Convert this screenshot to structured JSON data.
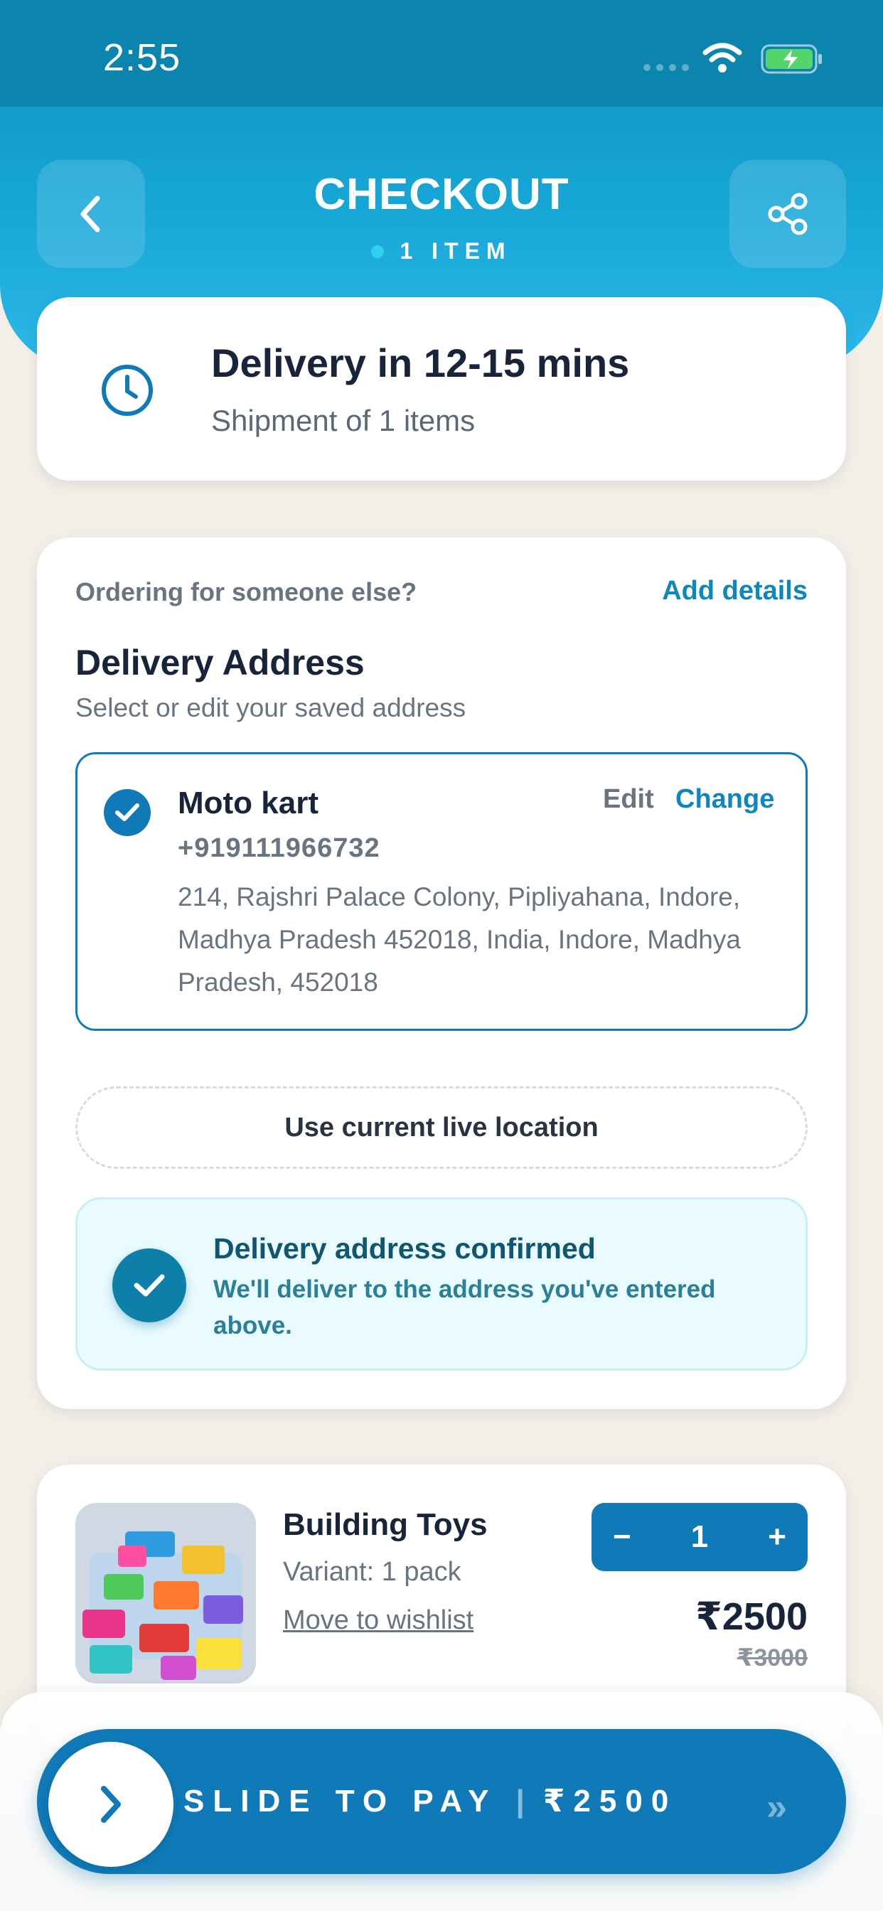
{
  "status_bar": {
    "time": "2:55"
  },
  "header": {
    "title": "CHECKOUT",
    "subtitle": "1 ITEM"
  },
  "delivery": {
    "title": "Delivery in 12-15 mins",
    "subtitle": "Shipment of 1 items"
  },
  "address_section": {
    "ordering_prompt": "Ordering for someone else?",
    "add_details": "Add details",
    "title": "Delivery Address",
    "subtitle": "Select or edit your saved address",
    "selected_address": {
      "name": "Moto kart",
      "phone": "+919111966732",
      "address": "214, Rajshri Palace Colony, Pipliyahana, Indore, Madhya Pradesh 452018, India, Indore, Madhya Pradesh, 452018",
      "edit": "Edit",
      "change": "Change"
    },
    "live_location": "Use current live location",
    "confirmation": {
      "title": "Delivery address confirmed",
      "text": "We'll deliver to the address you've entered above."
    }
  },
  "item": {
    "name": "Building Toys",
    "variant": "Variant: 1 pack",
    "wishlist": "Move to wishlist",
    "quantity": "1",
    "minus": "−",
    "plus": "+",
    "price": "₹2500",
    "mrp": "₹3000"
  },
  "pay": {
    "label": "SLIDE TO PAY",
    "separator": "|",
    "amount": "₹2500",
    "arrows": "»"
  },
  "colors": {
    "primary": "#0f7ab7",
    "header": "#16a6d6",
    "background": "#f3efe8"
  }
}
